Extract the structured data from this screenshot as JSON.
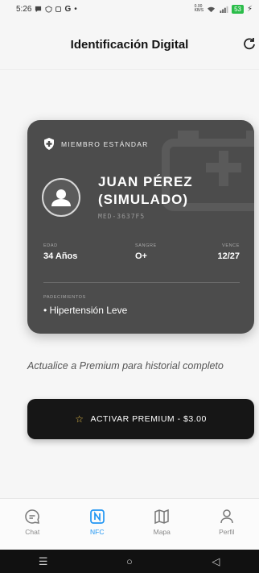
{
  "status_bar": {
    "time": "5:26",
    "left_icons": [
      "chat-bubble-icon",
      "shield-icon",
      "scan-icon",
      "google-g-icon",
      "dot-icon"
    ],
    "g_label": "G",
    "net_speed": "0.00\nKB/S",
    "battery": "53"
  },
  "header": {
    "title": "Identificación Digital",
    "refresh_icon": "refresh-icon"
  },
  "card": {
    "tier": "MIEMBRO ESTÁNDAR",
    "holder_name": "JUAN PÉREZ (SIMULADO)",
    "member_id": "MED-3637F5",
    "age_label": "EDAD",
    "age_value": "34 Años",
    "blood_label": "SANGRE",
    "blood_value": "O+",
    "expires_label": "VENCE",
    "expires_value": "12/27",
    "conditions_label": "PADECIMIENTOS",
    "conditions_value": "• Hipertensión Leve",
    "background_color": "#4c4c4c"
  },
  "upsell": {
    "text": "Actualice a Premium para historial completo",
    "button_label": "ACTIVAR PREMIUM - $3.00",
    "button_icon": "star-icon",
    "accent_color": "#e8c04a"
  },
  "bottom_nav": {
    "active_color": "#2196f3",
    "items": [
      {
        "label": "Chat",
        "icon": "chat-icon",
        "active": false
      },
      {
        "label": "NFC",
        "icon": "nfc-icon",
        "active": true
      },
      {
        "label": "Mapa",
        "icon": "map-icon",
        "active": false
      },
      {
        "label": "Perfil",
        "icon": "user-icon",
        "active": false
      }
    ]
  },
  "system_nav": {
    "menu": "☰",
    "home": "○",
    "back": "◁"
  }
}
